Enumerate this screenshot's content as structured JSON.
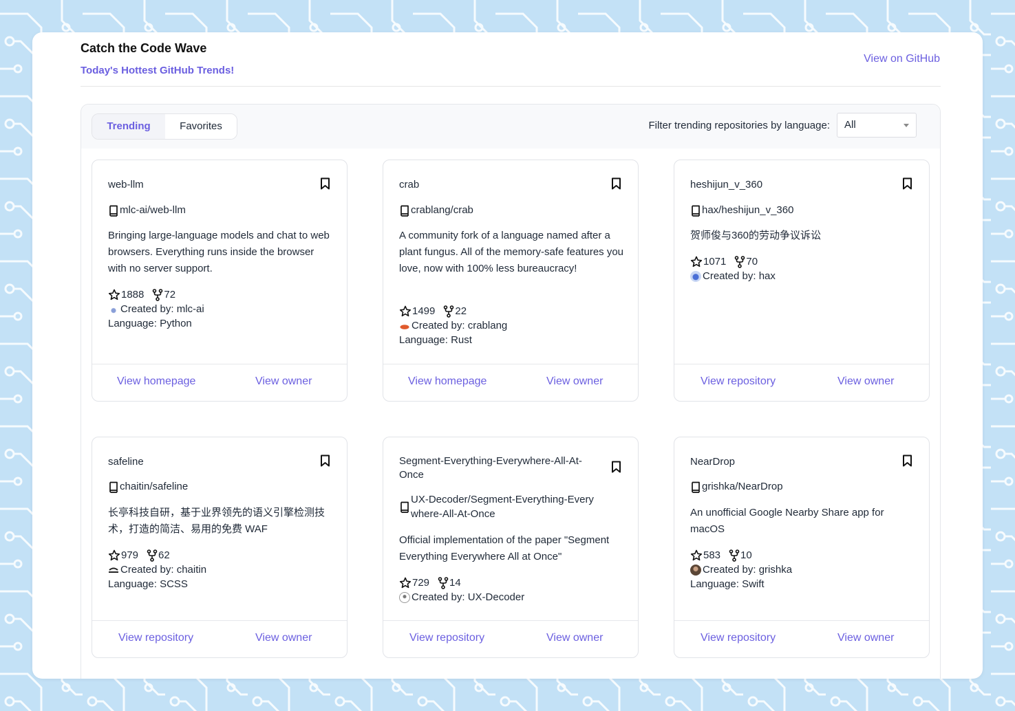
{
  "header": {
    "title": "Catch the Code Wave",
    "subtitle": "Today's Hottest GitHub Trends!",
    "github_link": "View on GitHub"
  },
  "tabs": [
    {
      "label": "Trending",
      "active": true
    },
    {
      "label": "Favorites",
      "active": false
    }
  ],
  "filter": {
    "label": "Filter trending repositories by language:",
    "selected": "All"
  },
  "colors": {
    "accent": "#6b5fe0",
    "background": "#c3e1f6",
    "pattern": "#ffffff"
  },
  "cards": [
    {
      "name": "web-llm",
      "repo": "mlc-ai/web-llm",
      "description": "Bringing large-language models and chat to web browsers. Everything runs inside the browser with no server support.",
      "stars": "1888",
      "forks": "72",
      "creator": "Created by: mlc-ai",
      "language": "Language: Python",
      "link_primary": "View homepage",
      "link_owner": "View owner",
      "avatar_icon": "mlc-ai-avatar"
    },
    {
      "name": "crab",
      "repo": "crablang/crab",
      "description": "A community fork of a language named after a plant fungus. All of the memory-safe features you love, now with 100% less bureaucracy!",
      "stars": "1499",
      "forks": "22",
      "creator": "Created by: crablang",
      "language": "Language: Rust",
      "link_primary": "View homepage",
      "link_owner": "View owner",
      "avatar_icon": "crab-avatar"
    },
    {
      "name": "heshijun_v_360",
      "repo": "hax/heshijun_v_360",
      "description": "贺师俊与360的劳动争议诉讼",
      "stars": "1071",
      "forks": "70",
      "creator": "Created by: hax",
      "language": "",
      "link_primary": "View repository",
      "link_owner": "View owner",
      "avatar_icon": "hax-avatar"
    },
    {
      "name": "safeline",
      "repo": "chaitin/safeline",
      "description": "长亭科技自研，基于业界领先的语义引擎检测技术，打造的简洁、易用的免费 WAF",
      "stars": "979",
      "forks": "62",
      "creator": "Created by: chaitin",
      "language": "Language: SCSS",
      "link_primary": "View repository",
      "link_owner": "View owner",
      "avatar_icon": "chaitin-avatar"
    },
    {
      "name": "Segment-Everything-Everywhere-All-At-Once",
      "repo": "UX-Decoder/Segment-Everything-Everywhere-All-At-Once",
      "description": "Official implementation of the paper \"Segment Everything Everywhere All at Once\"",
      "stars": "729",
      "forks": "14",
      "creator": "Created by: UX-Decoder",
      "language": "",
      "link_primary": "View repository",
      "link_owner": "View owner",
      "avatar_icon": "ux-decoder-avatar"
    },
    {
      "name": "NearDrop",
      "repo": "grishka/NearDrop",
      "description": "An unofficial Google Nearby Share app for macOS",
      "stars": "583",
      "forks": "10",
      "creator": "Created by: grishka",
      "language": "Language: Swift",
      "link_primary": "View repository",
      "link_owner": "View owner",
      "avatar_icon": "grishka-avatar"
    }
  ]
}
